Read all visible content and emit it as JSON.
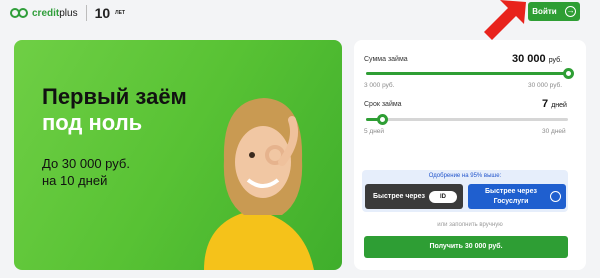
{
  "header": {
    "logo_brand": "credit",
    "logo_brand_rest": "plus",
    "logo_anniversary": "10",
    "logo_years": "ЛЕТ",
    "login_label": "Войти"
  },
  "hero": {
    "title_line1": "Первый заём",
    "title_line2": "под ноль",
    "sub_line1": "До 30 000 руб.",
    "sub_line2": "на 10 дней"
  },
  "calculator": {
    "amount": {
      "label": "Сумма займа",
      "value": "30 000",
      "unit": "руб.",
      "min": "3 000 руб.",
      "max": "30 000 руб.",
      "fraction": 1.0
    },
    "term": {
      "label": "Срок займа",
      "value": "7",
      "unit": "дней",
      "min": "5 дней",
      "max": "30 дней",
      "fraction": 0.08
    },
    "approval_hint": "Одобрение на 95% выше:",
    "faster_id_label": "Быстрее через",
    "faster_id_badge": "ID",
    "faster_gos_line1": "Быстрее через",
    "faster_gos_line2": "Госуслуги",
    "manual_link": "или заполнить вручную",
    "submit_label": "Получить 30 000 руб."
  },
  "colors": {
    "brand_green": "#2e9e34",
    "hero_green": "#58c234",
    "gos_blue": "#1f5fcf",
    "annotation_red": "#e8231c"
  },
  "icons": [
    "logo-icon",
    "arrow-right-icon",
    "id-badge-icon",
    "gosuslugi-icon",
    "annotation-arrow-icon"
  ]
}
